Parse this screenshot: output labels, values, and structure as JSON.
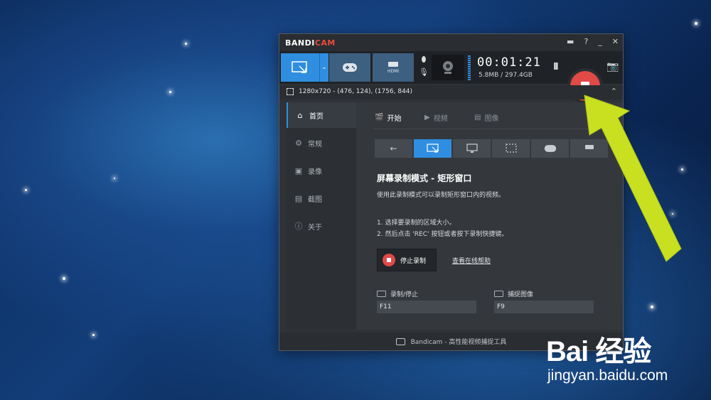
{
  "window": {
    "brand_prefix": "BANDI",
    "brand_suffix": "CAM",
    "title_icons": [
      "folder-icon",
      "help-icon",
      "minimize-icon",
      "close-icon"
    ]
  },
  "toolbar": {
    "timer": "00:01:21",
    "size": "5.8MB / 297.4GB",
    "pause_label": "II",
    "modes": [
      "rectangle-mode",
      "game-mode",
      "hdmi-mode"
    ],
    "hdmi_label": "HDMI"
  },
  "area": {
    "text": "1280x720 - (476, 124), (1756, 844)"
  },
  "sidebar": {
    "items": [
      {
        "label": "首页",
        "icon": "home-icon",
        "active": true
      },
      {
        "label": "常规",
        "icon": "gear-icon",
        "active": false
      },
      {
        "label": "录像",
        "icon": "video-icon",
        "active": false
      },
      {
        "label": "截图",
        "icon": "image-icon",
        "active": false
      },
      {
        "label": "关于",
        "icon": "info-icon",
        "active": false
      }
    ]
  },
  "content": {
    "tabs": [
      {
        "label": "开始",
        "active": true
      },
      {
        "label": "视频",
        "active": false
      },
      {
        "label": "图像",
        "active": false
      }
    ],
    "mode_tabs": [
      "back-arrow",
      "rectangle",
      "fullscreen",
      "around-mouse",
      "game",
      "hdmi"
    ],
    "title": "屏幕录制模式 - 矩形窗口",
    "description": "使用此录制模式可以录制矩形窗口内的视频。",
    "step1": "1. 选择要录制的区域大小。",
    "step2": "2. 然后点击 'REC' 按钮或者按下录制快捷键。",
    "stop_button": "停止录制",
    "help_link": "查看在线帮助",
    "hotkeys": [
      {
        "label": "录制/停止",
        "value": "F11"
      },
      {
        "label": "捕捉图像",
        "value": "F9"
      }
    ]
  },
  "status": {
    "text": "Bandicam - 高性能视频捕捉工具"
  },
  "watermark": {
    "brand": "Bai 经验",
    "url": "jingyan.baidu.com"
  },
  "colors": {
    "accent": "#2f8ee0",
    "record": "#e04a47",
    "arrow": "#c9e021"
  }
}
